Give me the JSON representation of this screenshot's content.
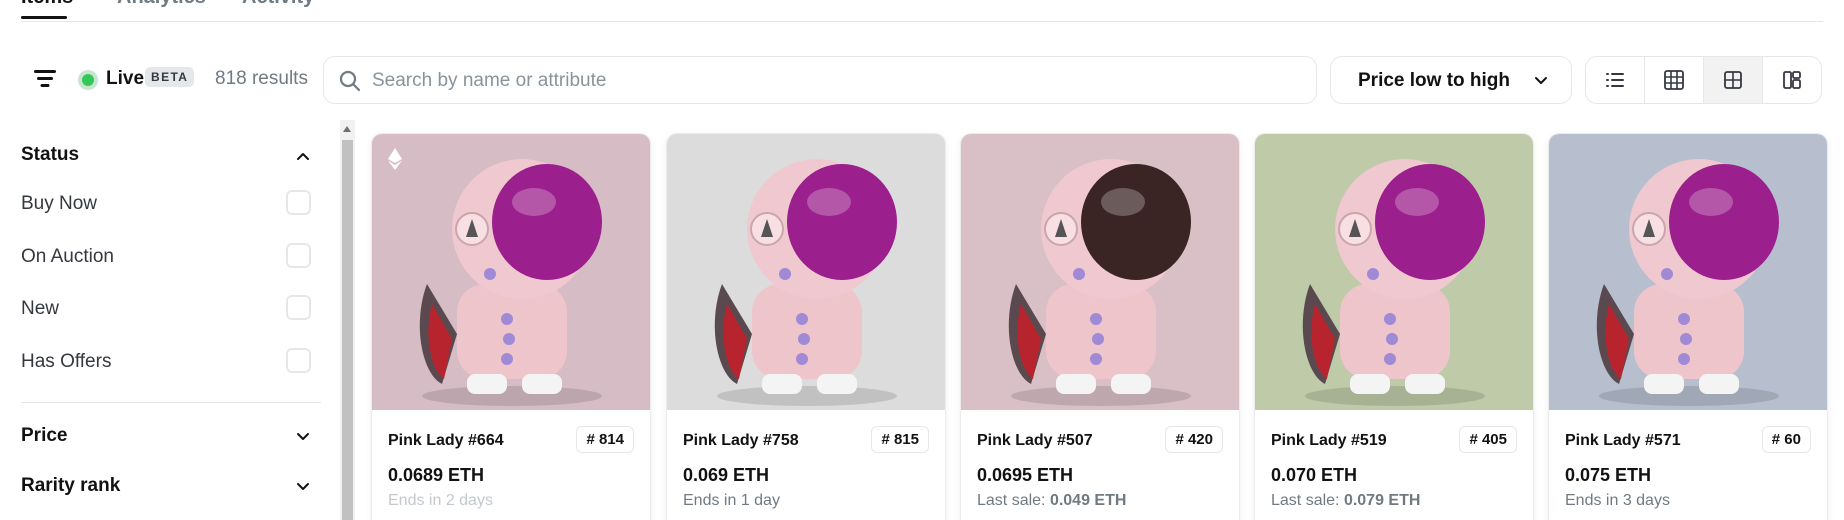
{
  "tabs": [
    {
      "label": "Items"
    },
    {
      "label": "Analytics"
    },
    {
      "label": "Activity"
    }
  ],
  "toolbar": {
    "live_label": "Live",
    "beta_label": "BETA",
    "results": "818 results",
    "search_placeholder": "Search by name or attribute",
    "sort_label": "Price low to high",
    "views": [
      "list-view",
      "grid-small-view",
      "grid-large-view",
      "masonry-view"
    ],
    "active_view": "grid-large-view",
    "live_color": "#34c759"
  },
  "sidebar": {
    "status": {
      "title": "Status",
      "options": [
        {
          "label": "Buy Now"
        },
        {
          "label": "On Auction"
        },
        {
          "label": "New"
        },
        {
          "label": "Has Offers"
        }
      ]
    },
    "price": {
      "title": "Price"
    },
    "rarity": {
      "title": "Rarity rank"
    }
  },
  "cards": [
    {
      "name": "Pink Lady #664",
      "rank": "# 814",
      "price": "0.0689 ETH",
      "meta": "Ends in 2 days",
      "bg": "#d6bcc4",
      "helmet": "#9b1f8c",
      "hair": ""
    },
    {
      "name": "Pink Lady #758",
      "rank": "# 815",
      "price": "0.069 ETH",
      "meta": "Ends in 1 day",
      "bg": "#dcdcdc",
      "helmet": "#9b1f8c",
      "hair": ""
    },
    {
      "name": "Pink Lady #507",
      "rank": "# 420",
      "price": "0.0695 ETH",
      "meta_prefix": "Last sale: ",
      "meta_value": "0.049 ETH",
      "bg": "#d9c0c6",
      "helmet": "#3a2524",
      "hair": "#c9b24a"
    },
    {
      "name": "Pink Lady #519",
      "rank": "# 405",
      "price": "0.070 ETH",
      "meta_prefix": "Last sale: ",
      "meta_value": "0.079 ETH",
      "bg": "#bfcaa9",
      "helmet": "#9b1f8c",
      "hair": "#2a2520"
    },
    {
      "name": "Pink Lady #571",
      "rank": "# 60",
      "price": "0.075 ETH",
      "meta": "Ends in 3 days",
      "bg": "#b7bfcf",
      "helmet": "#9b1f8c",
      "hair": "#3b3227"
    }
  ]
}
